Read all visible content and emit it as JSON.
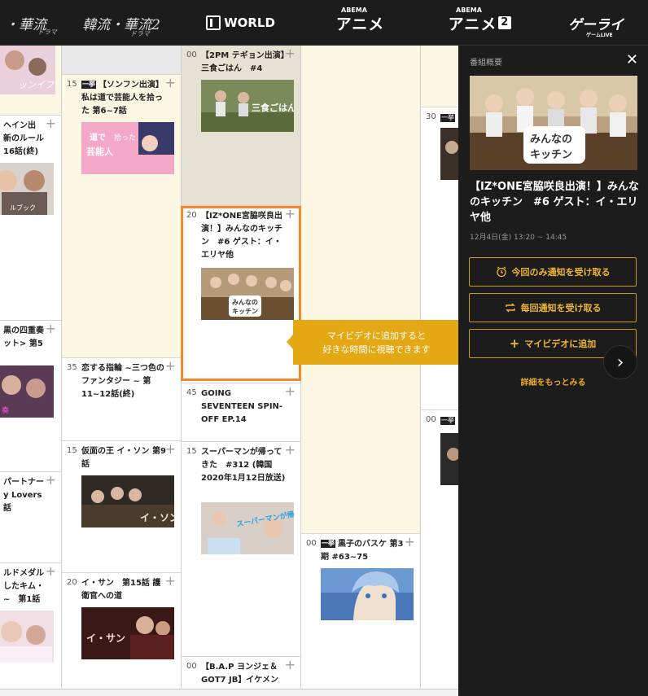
{
  "channels": {
    "c1_main": "・華流",
    "c1_sub": "ドラマ",
    "c2_main": "韓流・華流2",
    "c2_sub": "ドラマ",
    "c3": "WORLD",
    "c4": "アニメ",
    "c4_top": "ABEMA",
    "c5": "アニメ",
    "c5_num": "2",
    "c5_top": "ABEMA",
    "c6": "ゲーライ",
    "c6_sub": "ゲームLIVE"
  },
  "new_badge": "一挙",
  "col0": [
    {
      "title1": "ヘイン出",
      "title2": "新のルール",
      "title3": "16話(終)"
    },
    {
      "title1": "黒の四重奏",
      "title2": "ット> 第5",
      "title3": ""
    },
    {
      "title1": "パートナー",
      "title2": "y Lovers",
      "title3": "話"
    },
    {
      "title1": "ルドメダル",
      "title2": "したキム・",
      "title3": "~　第1話"
    }
  ],
  "col1": [
    {
      "min": "15",
      "title": "【ソンフン出演】私は道で芸能人を拾った 第6~7話"
    },
    {
      "min": "35",
      "title": "恋する指輪 ~三つ色のファンタジー ~ 第11~12話(終)"
    },
    {
      "min": "15",
      "title": "仮面の王 イ・ソン 第9話"
    },
    {
      "min": "20",
      "title": "イ・サン　第15話 護衛官への道"
    }
  ],
  "col2": [
    {
      "min": "00",
      "title": "【2PM テギョン出演】三食ごはん　#4"
    },
    {
      "min": "20",
      "title": "【IZ*ONE宮脇咲良出演！】みんなのキッチン　#6 ゲスト：イ・エリヤ他"
    },
    {
      "min": "45",
      "title": "GOING SEVENTEEN SPIN-OFF EP.14"
    },
    {
      "min": "15",
      "title": "スーパーマンが帰ってきた　#312 (韓国2020年1月12日放送)"
    },
    {
      "min": "00",
      "title": "【B.A.P ヨンジェ＆GOT7 JB】イケメン"
    }
  ],
  "col3": [
    {
      "min": "00",
      "title": "黒子のバスケ 第3期 #63~75"
    }
  ],
  "col4": [
    {
      "min": "30",
      "title": ""
    },
    {
      "min": "00",
      "title": ""
    }
  ],
  "thumb_text": {
    "sanshoku": "三食ごはん",
    "kitchen1": "みんなの",
    "kitchen2": "キッチン",
    "geinou1": "道で",
    "geinou2": "芸能人",
    "geinou3": "拾った",
    "ison": "イ・ソン",
    "isan": "イ・サン",
    "superman": "スーパーマンが帰ってきた"
  },
  "tooltip": {
    "line1": "マイビデオに追加すると",
    "line2": "好きな時間に視聴できます"
  },
  "panel": {
    "header": "番組概要",
    "close": "✕",
    "title": "【IZ*ONE宮脇咲良出演！】みんなのキッチン　#6 ゲスト：イ・エリヤ他",
    "time": "12月4日(金) 13:20 ~ 14:45",
    "btn_once": "今回のみ通知を受け取る",
    "btn_every": "毎回通知を受け取る",
    "btn_myvideo": "マイビデオに追加",
    "more": "詳細をもっとみる",
    "thumb1": "みんなの",
    "thumb2": "キッチン"
  },
  "colors": {
    "accent": "#e3a813",
    "highlight": "#ee8a2a",
    "panel_bg": "#1c1c1c"
  }
}
